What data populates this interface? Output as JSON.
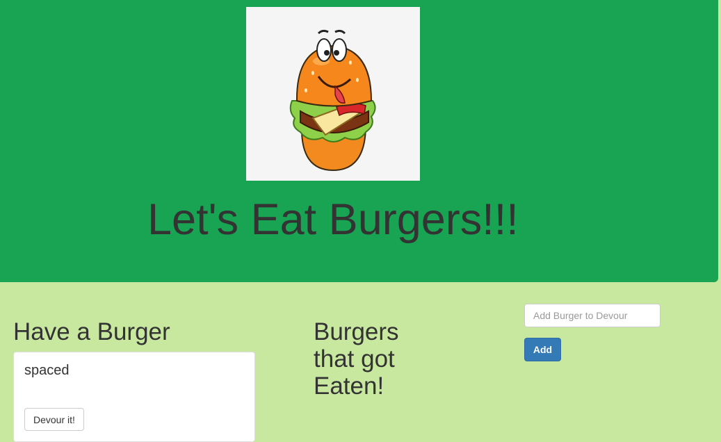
{
  "header": {
    "title": "Let's Eat Burgers!!!",
    "logo_icon": "burger-mascot-icon"
  },
  "uneaten": {
    "heading": "Have a Burger",
    "burgers": [
      {
        "name": "spaced",
        "devour_label": "Devour it!"
      }
    ]
  },
  "eaten": {
    "heading": "Burgers that got Eaten!"
  },
  "add_form": {
    "placeholder": "Add Burger to Devour",
    "value": "",
    "submit_label": "Add"
  },
  "colors": {
    "header_bg": "#18a452",
    "page_bg": "#c8e8a0",
    "primary_button": "#337ab7",
    "text": "#333333"
  }
}
